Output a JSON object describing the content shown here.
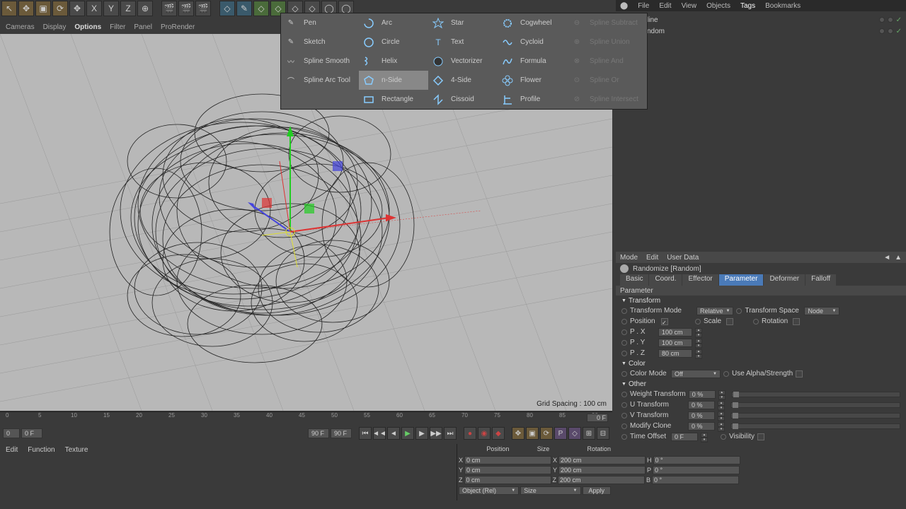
{
  "top_menu": {
    "file": "File",
    "edit": "Edit",
    "view": "View",
    "objects": "Objects",
    "tags": "Tags",
    "bookmarks": "Bookmarks"
  },
  "sub_toolbar": {
    "cameras": "Cameras",
    "display": "Display",
    "options": "Options",
    "filter": "Filter",
    "panel": "Panel",
    "prorender": "ProRender"
  },
  "dropdown": {
    "pen": "Pen",
    "sketch": "Sketch",
    "smooth": "Spline Smooth",
    "arc_tool": "Spline Arc Tool",
    "arc": "Arc",
    "circle": "Circle",
    "helix": "Helix",
    "nside": "n-Side",
    "rectangle": "Rectangle",
    "star": "Star",
    "text": "Text",
    "vectorizer": "Vectorizer",
    "fourside": "4-Side",
    "cissoid": "Cissoid",
    "cogwheel": "Cogwheel",
    "cycloid": "Cycloid",
    "formula": "Formula",
    "flower": "Flower",
    "profile": "Profile",
    "subtract": "Spline Subtract",
    "union": "Spline Union",
    "and": "Spline And",
    "or": "Spline Or",
    "intersect": "Spline Intersect"
  },
  "grid_info": "Grid Spacing : 100 cm",
  "obj_panel": {
    "item1": "line",
    "item2": "ndom"
  },
  "attr": {
    "mode": "Mode",
    "edit": "Edit",
    "userdata": "User Data",
    "title": "Randomize [Random]",
    "tabs": {
      "basic": "Basic",
      "coord": "Coord.",
      "effector": "Effector",
      "parameter": "Parameter",
      "deformer": "Deformer",
      "falloff": "Falloff"
    },
    "section": "Parameter",
    "transform_grp": "Transform",
    "transform_mode": "Transform Mode",
    "transform_mode_val": "Relative",
    "transform_space": "Transform Space",
    "transform_space_val": "Node",
    "position": "Position",
    "scale": "Scale",
    "rotation": "Rotation",
    "px": "P . X",
    "px_val": "100 cm",
    "py": "P . Y",
    "py_val": "100 cm",
    "pz": "P . Z",
    "pz_val": "80 cm",
    "color_grp": "Color",
    "color_mode": "Color Mode",
    "color_mode_val": "Off",
    "use_alpha": "Use Alpha/Strength",
    "other_grp": "Other",
    "weight": "Weight Transform",
    "weight_val": "0 %",
    "utrans": "U Transform",
    "utrans_val": "0 %",
    "vtrans": "V Transform",
    "vtrans_val": "0 %",
    "modify": "Modify Clone",
    "modify_val": "0 %",
    "time": "Time Offset",
    "time_val": "0 F",
    "visibility": "Visibility"
  },
  "timeline": {
    "ticks": [
      "0",
      "5",
      "10",
      "15",
      "20",
      "25",
      "30",
      "35",
      "40",
      "45",
      "50",
      "55",
      "60",
      "65",
      "70",
      "75",
      "80",
      "85",
      "90"
    ],
    "end": "0 F"
  },
  "transport": {
    "start": "0",
    "startf": "0 F",
    "endf": "90 F",
    "end": "90 F"
  },
  "bottom": {
    "edit": "Edit",
    "function": "Function",
    "texture": "Texture"
  },
  "coord": {
    "hdr_pos": "Position",
    "hdr_size": "Size",
    "hdr_rot": "Rotation",
    "x": "X",
    "y": "Y",
    "z": "Z",
    "xv": "0 cm",
    "yv": "0 cm",
    "zv": "0 cm",
    "sxv": "200 cm",
    "syv": "200 cm",
    "szv": "200 cm",
    "h": "H",
    "p": "P",
    "b": "B",
    "hv": "0 °",
    "pv": "0 °",
    "bv": "0 °",
    "obj": "Object (Rel)",
    "size": "Size",
    "apply": "Apply"
  }
}
